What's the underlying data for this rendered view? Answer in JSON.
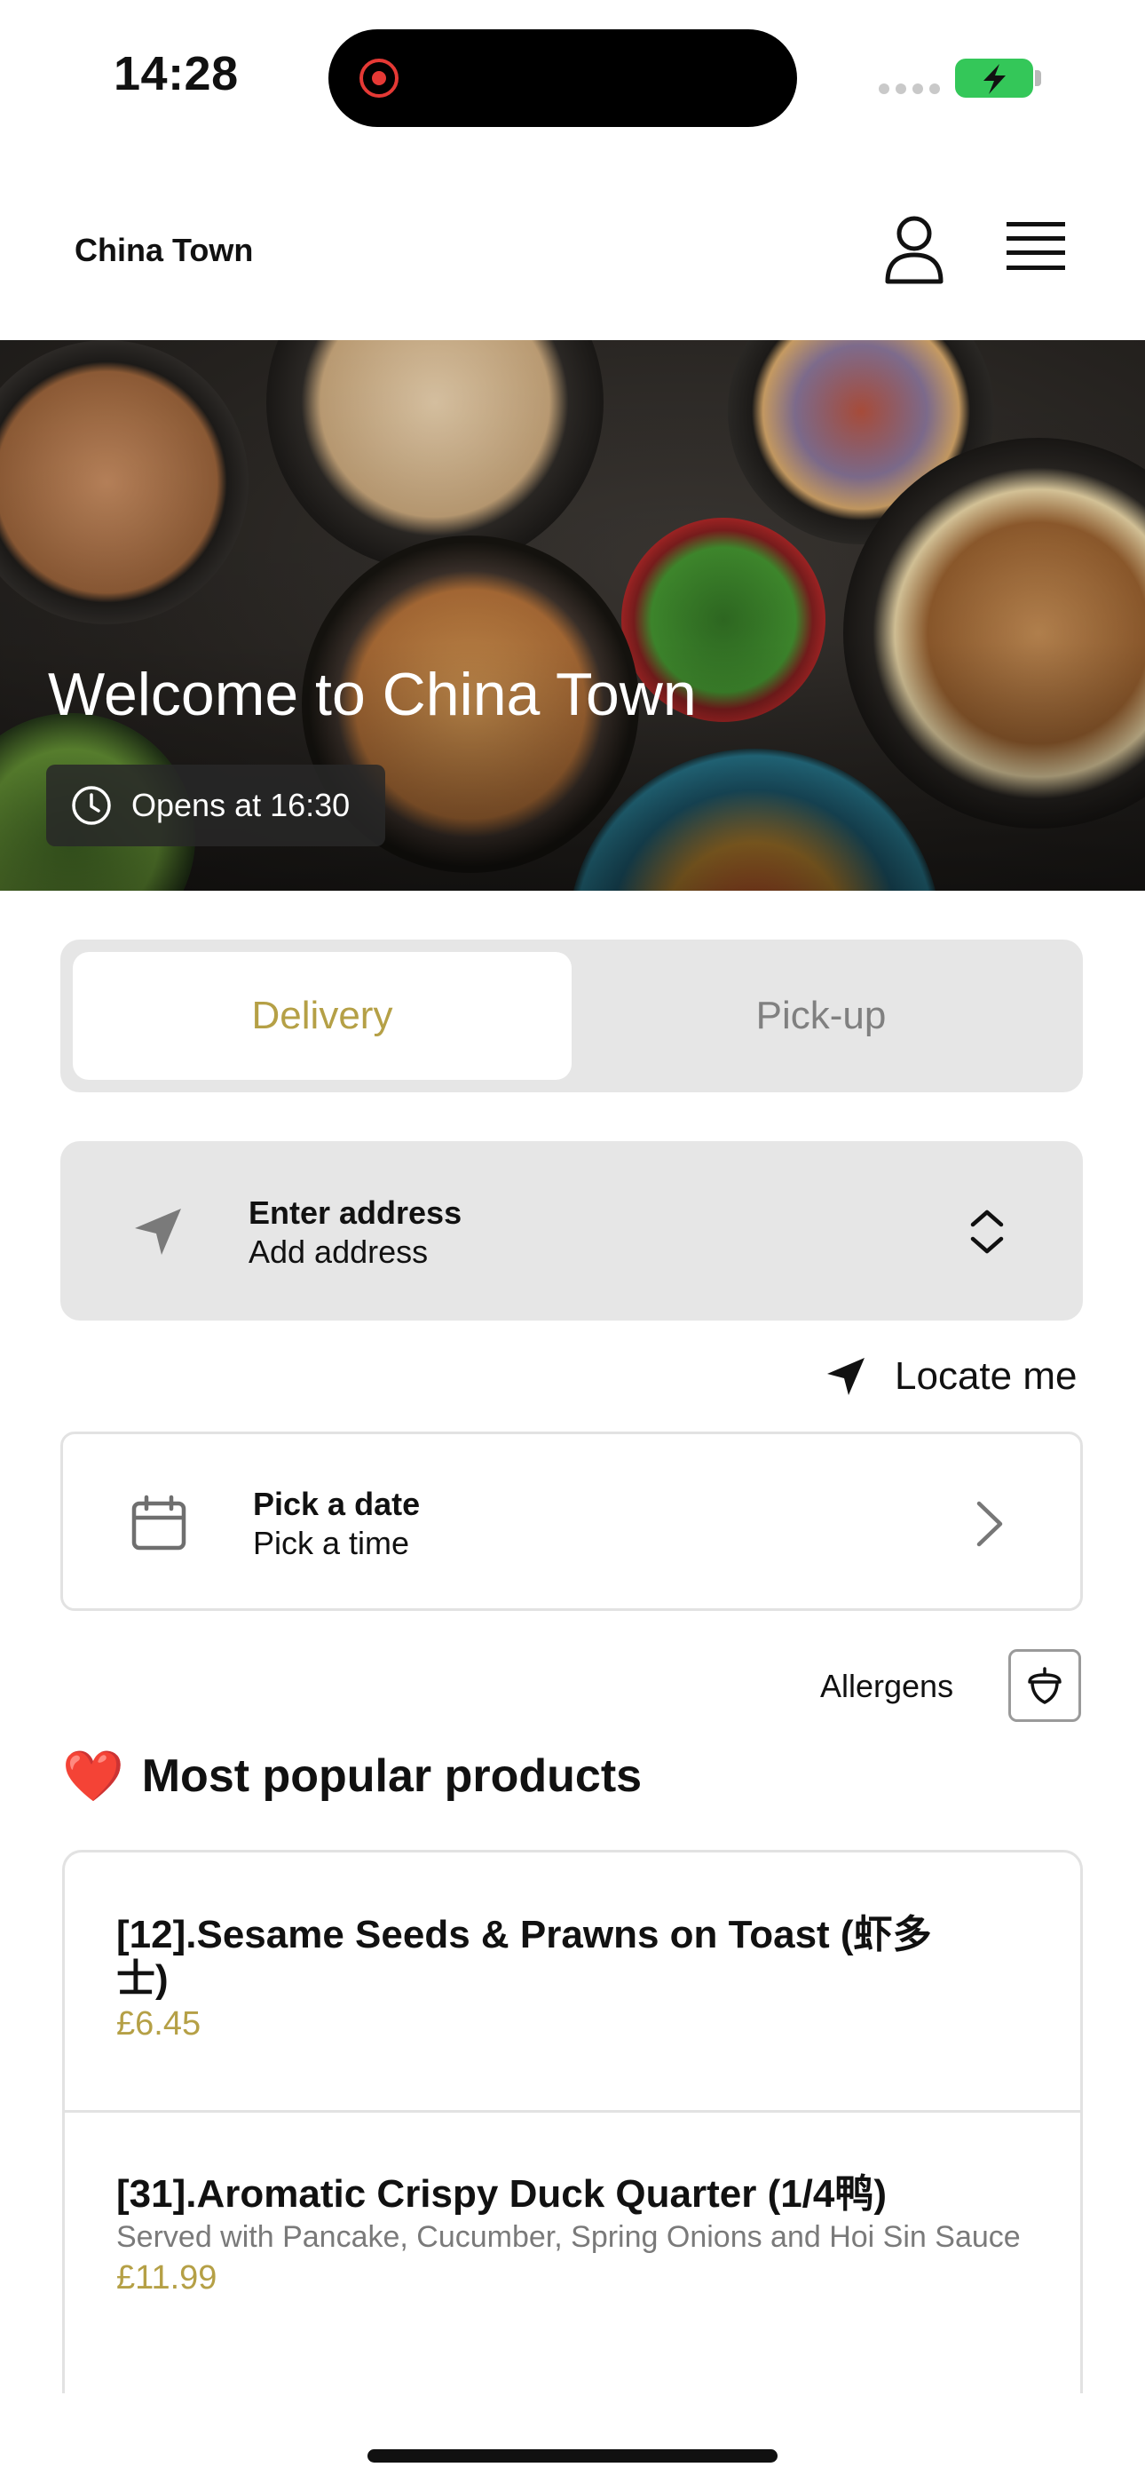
{
  "status_bar": {
    "time": "14:28"
  },
  "header": {
    "brand": "China Town"
  },
  "hero": {
    "title": "Welcome to China Town",
    "hours": "Opens at 16:30"
  },
  "order_mode": {
    "delivery_label": "Delivery",
    "pickup_label": "Pick-up",
    "selected": "Delivery"
  },
  "address": {
    "title": "Enter address",
    "subtitle": "Add address"
  },
  "locate": {
    "label": "Locate me"
  },
  "schedule": {
    "title": "Pick a date",
    "subtitle": "Pick a time"
  },
  "allergens": {
    "label": "Allergens"
  },
  "popular": {
    "heading": "Most popular products",
    "emoji": "❤️",
    "items": [
      {
        "name": "[12].Sesame Seeds & Prawns on Toast (虾多士)",
        "description": "",
        "price": "£6.45"
      },
      {
        "name": "[31].Aromatic Crispy Duck Quarter (1/4鸭)",
        "description": "Served with Pancake, Cucumber, Spring Onions and Hoi Sin Sauce",
        "price": "£11.99"
      }
    ]
  },
  "colors": {
    "accent": "#b5a046",
    "panel": "#e6e6e6",
    "border": "#e2e2e2"
  },
  "icons": [
    "user-icon",
    "menu-icon",
    "clock-icon",
    "navigation-arrow-icon",
    "chevron-up-down-icon",
    "calendar-icon",
    "chevron-right-icon",
    "acorn-icon",
    "heart-icon"
  ]
}
